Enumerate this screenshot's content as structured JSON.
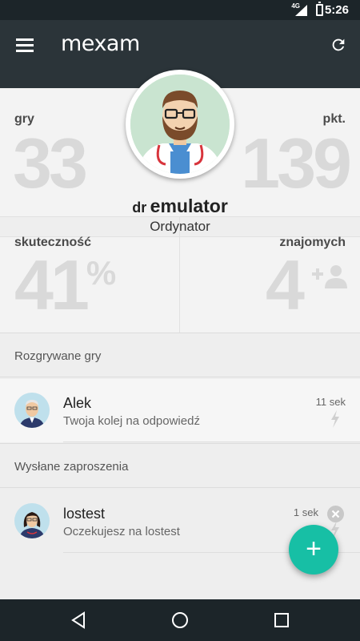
{
  "status_bar": {
    "network": "4G",
    "time": "5:26"
  },
  "app_bar": {
    "logo": "mexam",
    "menu_icon": "hamburger-menu-icon",
    "refresh_icon": "refresh-icon"
  },
  "profile": {
    "prefix": "dr",
    "name": "emulator",
    "rank": "Ordynator",
    "avatar_icon": "doctor-avatar-icon"
  },
  "stats": {
    "games_label": "gry",
    "games_value": "33",
    "points_label": "pkt.",
    "points_value": "139",
    "efficiency_label": "skuteczność",
    "efficiency_value": "41",
    "efficiency_unit": "%",
    "friends_label": "znajomych",
    "friends_value": "4",
    "add_friend_icon": "add-person-icon"
  },
  "sections": {
    "active_games_title": "Rozgrywane gry",
    "sent_invites_title": "Wysłane zaproszenia"
  },
  "active_games": [
    {
      "name": "Alek",
      "status": "Twoja kolej na odpowiedź",
      "time": "11 sek",
      "icon": "lightning-icon"
    }
  ],
  "sent_invites": [
    {
      "name": "lostest",
      "status": "Oczekujesz na lostest",
      "time": "1 sek",
      "icon": "lightning-icon"
    }
  ],
  "fab": {
    "label": "+"
  },
  "colors": {
    "accent": "#17bfa5",
    "app_bar": "#2b3439",
    "stat_value": "#d9d9d9"
  }
}
